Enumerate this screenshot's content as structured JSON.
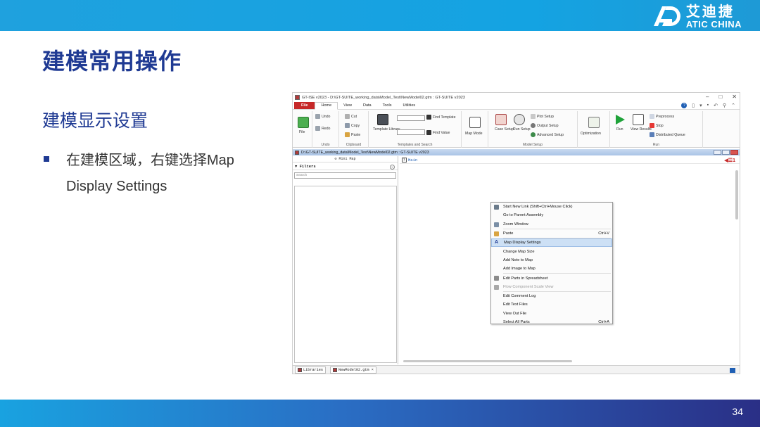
{
  "slide": {
    "title": "建模常用操作",
    "section_title": "建模显示设置",
    "bullet": "在建模区域，右键选择Map Display Settings",
    "page_number": "34"
  },
  "logo": {
    "cn": "艾迪捷",
    "en": "ATIC CHINA"
  },
  "app": {
    "title": "GT-ISE v2023 - D:\\GT-SUITE_working_data\\Model_Test\\NewModel02.gtm : GT-SUITE v2023",
    "window_buttons": [
      "–",
      "□",
      "✕"
    ],
    "tabs": [
      "File",
      "Home",
      "View",
      "Data",
      "Tools",
      "Utilities"
    ],
    "ribbon": {
      "file_label": "File",
      "undo_group": {
        "label": "Undo",
        "undo": "Undo",
        "redo": "Redo"
      },
      "clipboard_group": {
        "label": "Clipboard",
        "cut": "Cut",
        "copy": "Copy",
        "paste": "Paste"
      },
      "templates_group": {
        "label": "Templates and Search",
        "library": "Template Library",
        "find_template": "Find Template",
        "find_value": "Find Value"
      },
      "map_mode": "Map Mode",
      "model_setup_group": {
        "label": "Model Setup",
        "case_setup": "Case Setup",
        "run_setup": "Run Setup",
        "plot_setup": "Plot Setup",
        "output_setup": "Output Setup",
        "advanced_setup": "Advanced Setup"
      },
      "optimization": "Optimization",
      "run_group": {
        "label": "Run",
        "run": "Run",
        "view_results": "View Results",
        "preprocess": "Preprocess",
        "stop": "Stop",
        "distributed_queue": "Distributed Queue"
      }
    },
    "doc_title": "D:\\GT-SUITE_working_data\\Model_Test\\NewModel02.gtm : GT-SUITE v2023",
    "left_panel": {
      "mini_map": "Mini Map",
      "filters": "Filters",
      "search_placeholder": "Search"
    },
    "map_tab": {
      "number": "1",
      "label": "Main"
    },
    "level_indicator": "1",
    "context_menu": [
      {
        "label": "Start New Link (Shift+Ctrl+Mouse Click)",
        "shortcut": "",
        "icon": "link-icon",
        "state": "normal"
      },
      {
        "label": "Go to Parent Assembly",
        "shortcut": "",
        "icon": "",
        "state": "normal"
      },
      {
        "label": "Zoom Window",
        "shortcut": "",
        "icon": "zoom-icon",
        "state": "normal"
      },
      {
        "label": "Paste",
        "shortcut": "Ctrl+V",
        "icon": "paste-icon",
        "state": "normal"
      },
      {
        "label": "Map Display Settings",
        "shortcut": "",
        "icon": "font-a-icon",
        "state": "highlight"
      },
      {
        "label": "Change Map Size",
        "shortcut": "",
        "icon": "",
        "state": "normal"
      },
      {
        "label": "Add Note to Map",
        "shortcut": "",
        "icon": "",
        "state": "normal"
      },
      {
        "label": "Add Image to Map",
        "shortcut": "",
        "icon": "",
        "state": "normal"
      },
      {
        "label": "Edit Parts in Spreadsheet",
        "shortcut": "",
        "icon": "spreadsheet-icon",
        "state": "normal"
      },
      {
        "label": "Flow Component Scale View",
        "shortcut": "",
        "icon": "flow-icon",
        "state": "disabled"
      },
      {
        "label": "Edit Comment Log",
        "shortcut": "",
        "icon": "",
        "state": "normal"
      },
      {
        "label": "Edit Text Files",
        "shortcut": "",
        "icon": "",
        "state": "normal"
      },
      {
        "label": "View Out File",
        "shortcut": "",
        "icon": "",
        "state": "normal"
      },
      {
        "label": "Select All Parts",
        "shortcut": "Ctrl+A",
        "icon": "",
        "state": "normal"
      }
    ],
    "bottom_tabs": [
      "Libraries",
      "NewModel02.gtm ×"
    ]
  },
  "colors": {
    "title_blue": "#1f3a93",
    "banner": "#14a3e2",
    "file_tab": "#c62828",
    "highlight": "#cde0f5"
  }
}
